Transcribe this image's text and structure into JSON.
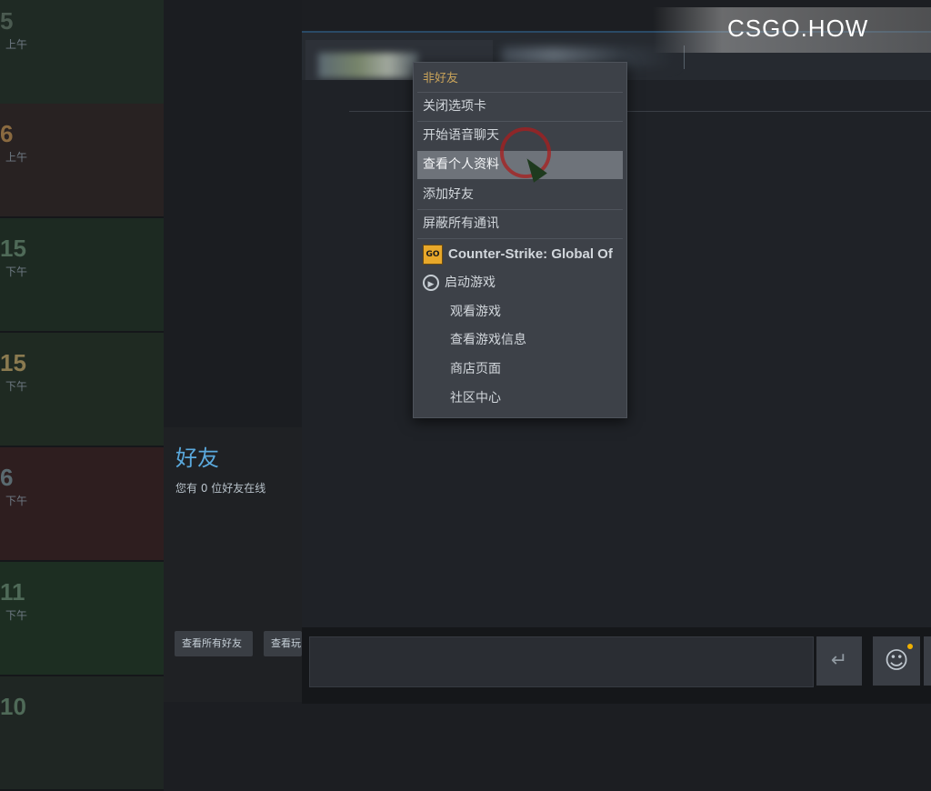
{
  "watermark": {
    "text": "CSGO.HOW"
  },
  "calendar": {
    "cells": [
      {
        "num": "5",
        "time": "上午",
        "bg": "#1f2a24",
        "color": "#4a5a50"
      },
      {
        "num": "6",
        "time": "上午",
        "bg": "#282222",
        "color": "#8a6a40"
      },
      {
        "num": "15",
        "time": "下午",
        "bg": "#1d2a22",
        "color": "#4f6a58"
      },
      {
        "num": "15",
        "time": "下午",
        "bg": "#1f2a22",
        "color": "#8a7a50"
      },
      {
        "num": "6",
        "time": "下午",
        "bg": "#2e1e1f",
        "color": "#5a6a70"
      },
      {
        "num": "11",
        "time": "下午",
        "bg": "#1d2e22",
        "color": "#4f6a58"
      },
      {
        "num": "10",
        "time": "",
        "bg": "#1f2623",
        "color": "#4f6a58"
      }
    ]
  },
  "friends": {
    "title": "好友",
    "subtitle": "您有 0 位好友在线",
    "buttons": [
      "查看所有好友",
      "查看玩"
    ]
  },
  "context_menu": {
    "header": "非好友",
    "items": [
      "关闭选项卡",
      "开始语音聊天",
      "查看个人资料",
      "添加好友",
      "屏蔽所有通讯"
    ],
    "highlighted_index": 2,
    "game": {
      "icon_text": "GO",
      "title": "Counter-Strike: Global Of",
      "launch": "启动游戏",
      "subitems": [
        "观看游戏",
        "查看游戏信息",
        "商店页面",
        "社区中心"
      ]
    }
  },
  "compose": {
    "send_icon": "↵",
    "emoji_icon": "☺"
  },
  "colors": {
    "accent": "#5aa9dd",
    "header_gold": "#c9a35a"
  }
}
